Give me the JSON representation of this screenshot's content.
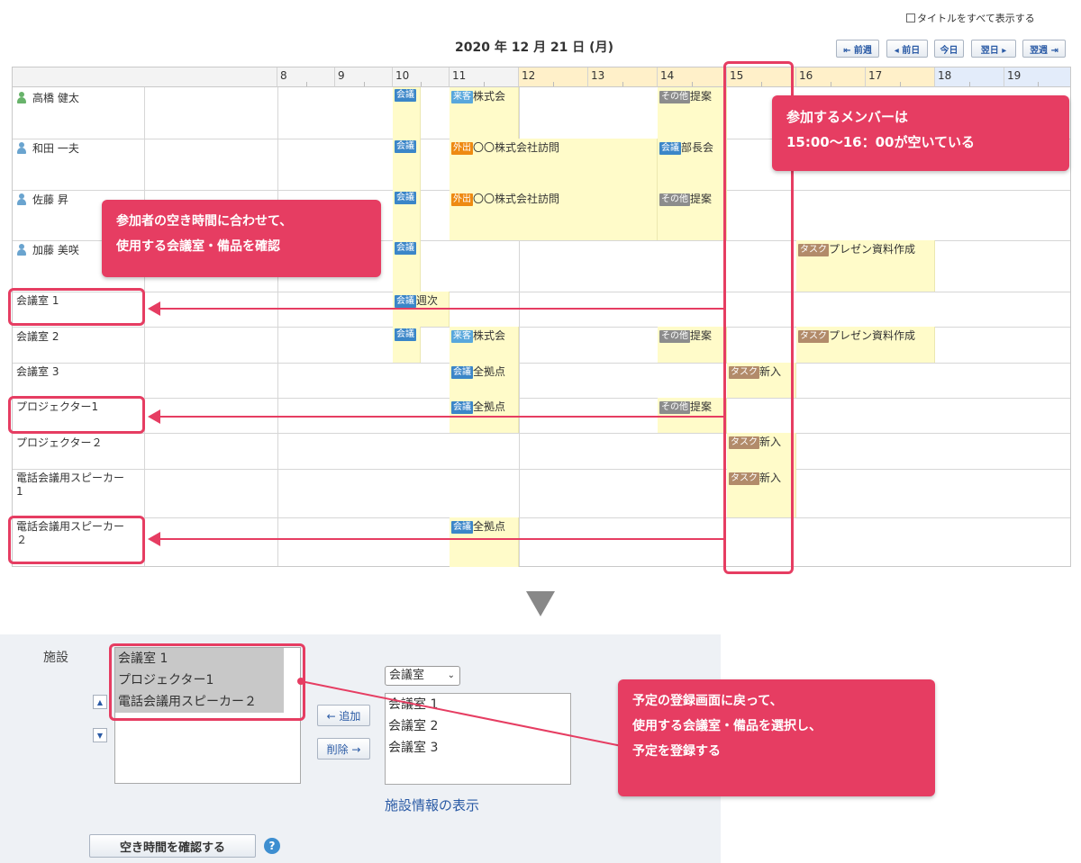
{
  "top": {
    "title_all_label": "タイトルをすべて表示する",
    "date_title": "2020 年 12 月 21 日 (月)",
    "nav": {
      "prev_week": "⇤ 前週",
      "prev_day": "◂ 前日",
      "today": "今日",
      "next_day": "翌日 ▸",
      "next_week": "翌週 ⇥"
    }
  },
  "grid": {
    "hours": [
      "8",
      "9",
      "10",
      "11",
      "12",
      "13",
      "14",
      "15",
      "16",
      "17",
      "18",
      "19"
    ],
    "rows": [
      {
        "name": "高橋 健太",
        "type": "user",
        "icon": "person-icon-green"
      },
      {
        "name": "和田 一夫",
        "type": "user",
        "icon": "person-icon"
      },
      {
        "name": "佐藤 昇",
        "type": "user",
        "icon": "person-icon"
      },
      {
        "name": "加藤 美咲",
        "type": "user",
        "icon": "person-icon"
      },
      {
        "name": "会議室 1",
        "type": "facility"
      },
      {
        "name": "会議室 2",
        "type": "facility"
      },
      {
        "name": "会議室 3",
        "type": "facility"
      },
      {
        "name": "プロジェクター1",
        "type": "facility"
      },
      {
        "name": "プロジェクター２",
        "type": "facility"
      },
      {
        "name": "電話会議用スピーカー\n1",
        "type": "facility"
      },
      {
        "name": "電話会議用スピーカー\n２",
        "type": "facility"
      }
    ],
    "events": {
      "r0_a": {
        "tag": "会議",
        "text": ""
      },
      "r0_b": {
        "tag": "来客",
        "text": "株式会"
      },
      "r0_c": {
        "tag": "その他",
        "text": "提案"
      },
      "r1_a": {
        "tag": "会議",
        "text": ""
      },
      "r1_b": {
        "tag": "外出",
        "text": "〇〇株式会社訪問"
      },
      "r1_c": {
        "tag": "会議",
        "text": "部長会"
      },
      "r2_a": {
        "tag": "会議",
        "text": ""
      },
      "r2_b": {
        "tag": "外出",
        "text": "〇〇株式会社訪問"
      },
      "r2_c": {
        "tag": "その他",
        "text": "提案"
      },
      "r3_a": {
        "tag": "会議",
        "text": ""
      },
      "r3_b": {
        "tag": "タスク",
        "text": "プレゼン資料作成"
      },
      "r4_a": {
        "tag": "会議",
        "text": "週次"
      },
      "r5_a": {
        "tag": "会議",
        "text": ""
      },
      "r5_b": {
        "tag": "来客",
        "text": "株式会"
      },
      "r5_c": {
        "tag": "その他",
        "text": "提案"
      },
      "r5_d": {
        "tag": "タスク",
        "text": "プレゼン資料作成"
      },
      "r6_a": {
        "tag": "会議",
        "text": "全拠点"
      },
      "r6_b": {
        "tag": "タスク",
        "text": "新入"
      },
      "r7_a": {
        "tag": "会議",
        "text": "全拠点"
      },
      "r7_b": {
        "tag": "その他",
        "text": "提案"
      },
      "r8_a": {
        "tag": "タスク",
        "text": "新入"
      },
      "r9_a": {
        "tag": "タスク",
        "text": "新入"
      },
      "r10_a": {
        "tag": "会議",
        "text": "全拠点"
      }
    }
  },
  "callouts": {
    "members_free": "参加するメンバーは\n15:00〜16：00が空いている",
    "check_rooms": "参加者の空き時間に合わせて、\n使用する会議室・備品を確認",
    "register": "予定の登録画面に戻って、\n使用する会議室・備品を選択し、\n予定を登録する"
  },
  "form": {
    "facility_label": "施設",
    "selected": [
      "会議室 1",
      "プロジェクター1",
      "電話会議用スピーカー２"
    ],
    "category_value": "会議室",
    "candidates": [
      "会議室 1",
      "会議室 2",
      "会議室 3"
    ],
    "add_label": "← 追加",
    "remove_label": "削除 →",
    "up_label": "▲",
    "down_label": "▼",
    "facility_info_link": "施設情報の表示",
    "check_free_label": "空き時間を確認する",
    "help_label": "?"
  },
  "colors": {
    "accent": "#e63d62",
    "event_bg": "#fffbc9",
    "link": "#2a5aa5",
    "header_highlight": "#fff0c9",
    "header_blue": "#e3ecfa"
  }
}
